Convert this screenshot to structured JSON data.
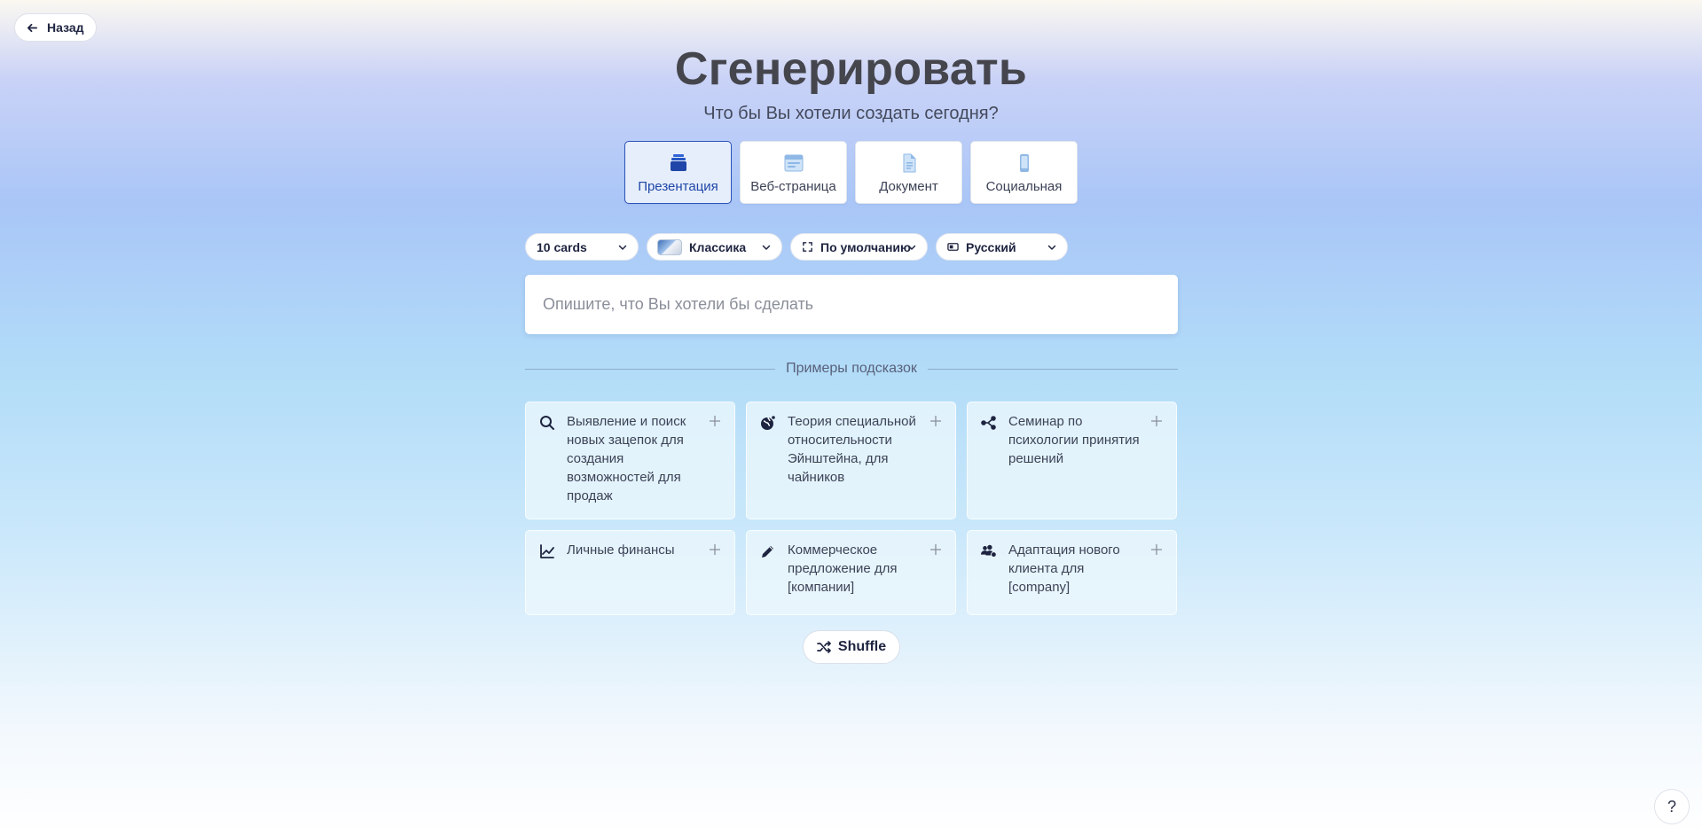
{
  "header": {
    "back_label": "Назад",
    "title": "Сгенерировать",
    "subtitle": "Что бы Вы хотели создать сегодня?"
  },
  "types": [
    {
      "label": "Презентация",
      "icon": "stack-icon",
      "selected": true
    },
    {
      "label": "Веб-страница",
      "icon": "webpage-icon",
      "selected": false
    },
    {
      "label": "Документ",
      "icon": "document-icon",
      "selected": false
    },
    {
      "label": "Социальная",
      "icon": "phone-icon",
      "selected": false
    }
  ],
  "controls": {
    "cards": "10 cards",
    "theme": "Классика",
    "size": "По умолчанию",
    "language": "Русский"
  },
  "prompt": {
    "placeholder": "Опишите, что Вы хотели бы сделать",
    "value": ""
  },
  "examples_label": "Примеры подсказок",
  "suggestions": [
    {
      "text": "Выявление и поиск новых зацепок для создания возможностей для продаж",
      "icon": "search-icon"
    },
    {
      "text": "Теория специальной относительности Эйнштейна, для чайников",
      "icon": "globe-icon"
    },
    {
      "text": "Семинар по психологии принятия решений",
      "icon": "share-nodes-icon"
    },
    {
      "text": "Личные финансы",
      "icon": "line-chart-icon"
    },
    {
      "text": "Коммерческое предложение для [компании]",
      "icon": "pencil-icon"
    },
    {
      "text": "Адаптация нового клиента для [company]",
      "icon": "users-icon"
    }
  ],
  "shuffle_label": "Shuffle",
  "help_label": "?",
  "colors": {
    "accent": "#2d52b8",
    "selected_bg": "#e6eefb",
    "text_dark": "#1e2440"
  }
}
